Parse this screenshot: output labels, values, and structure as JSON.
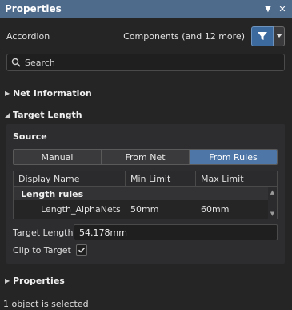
{
  "window": {
    "title": "Properties",
    "pin_icon": "triangle-down",
    "close_icon": "cross"
  },
  "toolbar": {
    "mode": "Accordion",
    "components": "Components (and 12 more)",
    "filter_icon": "funnel",
    "dropdown_icon": "triangle-down"
  },
  "search": {
    "placeholder": "Search",
    "icon": "magnifier"
  },
  "sections": {
    "net_information": "Net Information",
    "target_length": "Target Length",
    "properties": "Properties"
  },
  "target_length": {
    "source_label": "Source",
    "source_options": [
      "Manual",
      "From Net",
      "From Rules"
    ],
    "selected_source": "From Rules",
    "grid": {
      "columns": [
        "Display Name",
        "Min Limit",
        "Max Limit"
      ],
      "group": "Length rules",
      "rows": [
        {
          "display_name": "Length_AlphaNets",
          "min_limit": "50mm",
          "max_limit": "60mm"
        }
      ]
    },
    "target_length_label": "Target Length",
    "target_length_value": "54.178mm",
    "clip_to_target_label": "Clip to Target",
    "clip_to_target_checked": true
  },
  "status": {
    "text": "1 object is selected"
  },
  "colors": {
    "title_bar": "#4f6b8c",
    "accent": "#4e77a8",
    "background": "#252526"
  }
}
